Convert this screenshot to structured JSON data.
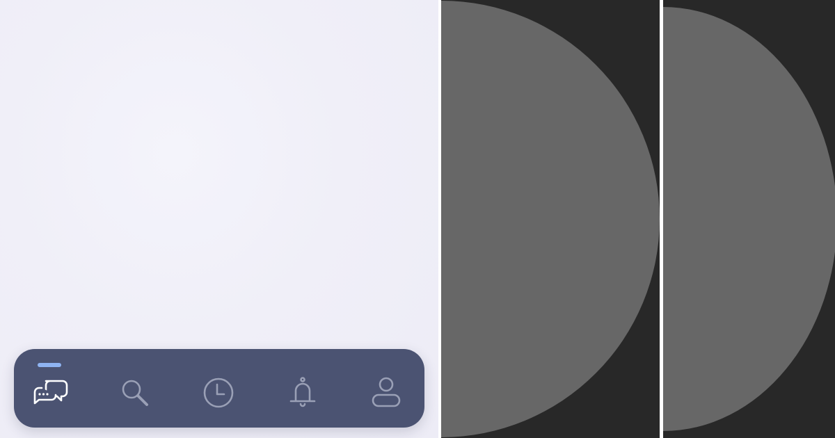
{
  "tab_bar": {
    "active_index": 0,
    "items": [
      {
        "label": "Chats",
        "icon": "chat-bubbles-icon"
      },
      {
        "label": "Search",
        "icon": "search-icon"
      },
      {
        "label": "History",
        "icon": "clock-icon"
      },
      {
        "label": "Notifications",
        "icon": "bell-icon"
      },
      {
        "label": "Profile",
        "icon": "user-icon"
      }
    ]
  },
  "colors": {
    "screen_background": "#efeef8",
    "tab_bar_background": "#4b5372",
    "active_indicator": "#8fb4f2",
    "active_icon": "#ffffff",
    "inactive_icon": "#9aa0b6",
    "panel_background": "#282828",
    "half_circle": "#676767"
  }
}
